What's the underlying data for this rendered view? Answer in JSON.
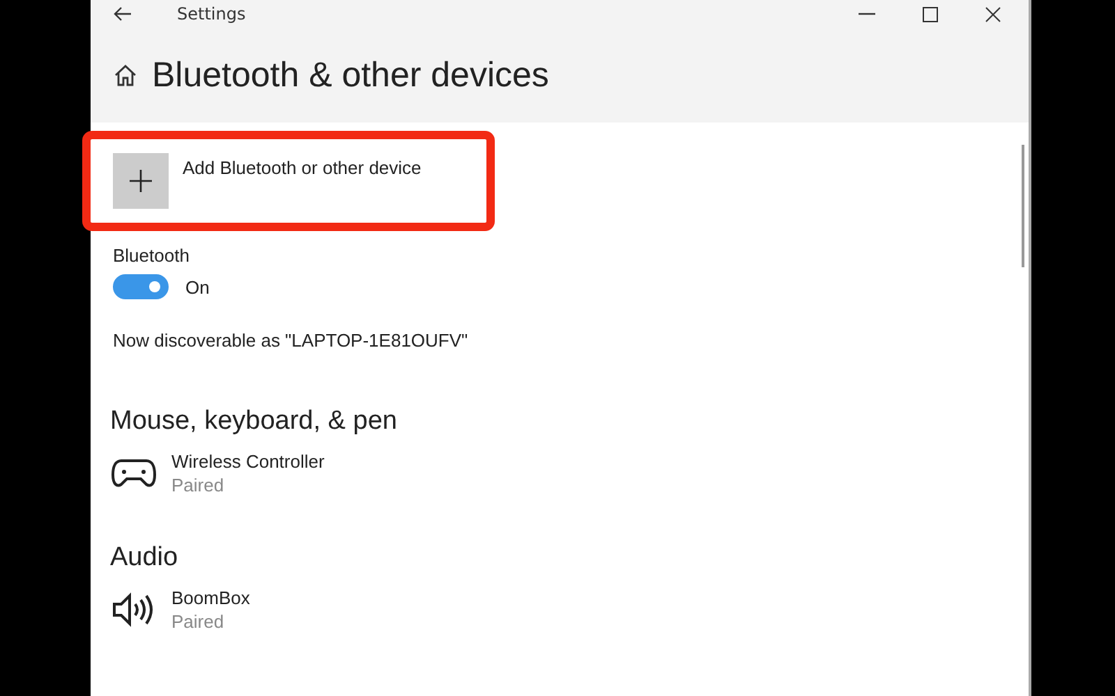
{
  "window": {
    "title": "Settings"
  },
  "header": {
    "title": "Bluetooth & other devices"
  },
  "add_device": {
    "label": "Add Bluetooth or other device",
    "highlighted": true
  },
  "bluetooth": {
    "label": "Bluetooth",
    "on": true,
    "state_label": "On",
    "discoverable": "Now discoverable as \"LAPTOP-1E81OUFV\""
  },
  "sections": [
    {
      "title": "Mouse, keyboard, & pen",
      "devices": [
        {
          "kind": "controller",
          "name": "Wireless Controller",
          "status": "Paired"
        }
      ]
    },
    {
      "title": "Audio",
      "devices": [
        {
          "kind": "speaker",
          "name": "BoomBox",
          "status": "Paired"
        }
      ]
    }
  ]
}
